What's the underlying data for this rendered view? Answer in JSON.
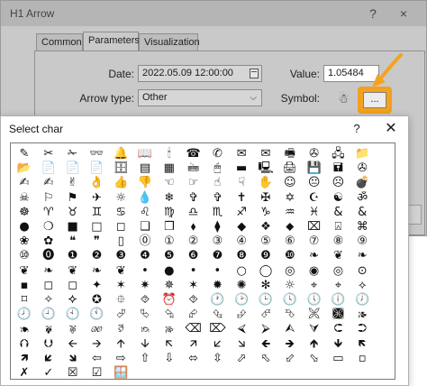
{
  "back_dialog": {
    "title": "H1 Arrow",
    "help_label": "?",
    "close_label": "×",
    "tabs": [
      {
        "label": "Common"
      },
      {
        "label": "Parameters"
      },
      {
        "label": "Visualization"
      }
    ],
    "date_label": "Date:",
    "date_value": "2022.05.09 12:00:00",
    "arrow_type_label": "Arrow type:",
    "arrow_type_value": "Other",
    "value_label": "Value:",
    "value_value": "1.05484",
    "symbol_label": "Symbol:",
    "symbol_preview": "☃",
    "browse_label": "...",
    "accent_color": "#f4a31f"
  },
  "char_dialog": {
    "title": "Select char",
    "help_label": "?",
    "close_label": "✕",
    "rows": [
      [
        "✎",
        "✂",
        "✁",
        "👓",
        "🔔",
        "📖",
        "🕯",
        "☎",
        "✆",
        "✉",
        "✉",
        "🖷",
        "✇",
        "🖧",
        "📁"
      ],
      [
        "📂",
        "📄",
        "📄",
        "📄",
        "🗄",
        "▤",
        "▦",
        "🖮",
        "🖱",
        "▬",
        "🖳",
        "🖨",
        "💾",
        "🖬",
        "✇"
      ],
      [
        "✍",
        "✍",
        "✌",
        "👌",
        "👍",
        "👎",
        "☜",
        "☞",
        "☝",
        "☟",
        "✋",
        "☺",
        "😐",
        "☹",
        "💣"
      ],
      [
        "☠",
        "⚐",
        "⚑",
        "✈",
        "☼",
        "💧",
        "❄",
        "✞",
        "✞",
        "✝",
        "✠",
        "✡",
        "☪",
        "☯",
        "ॐ"
      ],
      [
        "☸",
        "♈",
        "♉",
        "♊",
        "♋",
        "♌",
        "♍",
        "♎",
        "♏",
        "♐",
        "♑",
        "♒",
        "♓",
        "&",
        "&"
      ],
      [
        "●",
        "❍",
        "■",
        "□",
        "◻",
        "❑",
        "❒",
        "⬧",
        "⧫",
        "◆",
        "❖",
        "⬥",
        "⌧",
        "⍓",
        "⌘"
      ],
      [
        "❀",
        "✿",
        "❝",
        "❞",
        "▯",
        "⓪",
        "①",
        "②",
        "③",
        "④",
        "⑤",
        "⑥",
        "⑦",
        "⑧",
        "⑨"
      ],
      [
        "⑩",
        "⓿",
        "❶",
        "❷",
        "❸",
        "❹",
        "❺",
        "❻",
        "❼",
        "❽",
        "❾",
        "❿",
        "❧",
        "❦",
        "❧"
      ],
      [
        "❦",
        "❧",
        "❦",
        "❧",
        "❦",
        "•",
        "●",
        "•",
        "•",
        "○",
        "◯",
        "◎",
        "◉",
        "◎",
        "⊙"
      ],
      [
        "▪",
        "◻",
        "◻",
        "✦",
        "✶",
        "✷",
        "✵",
        "✶",
        "✹",
        "✺",
        "✻",
        "☼",
        "⌖",
        "⌖",
        "⟡"
      ],
      [
        "⌑",
        "✧",
        "⯎",
        "✪",
        "⯐",
        "⯑",
        "⏰",
        "⯑",
        "🕐",
        "🕑",
        "🕒",
        "🕓",
        "🕔",
        "🕕",
        "🕖"
      ],
      [
        "🕗",
        "🕘",
        "🕙",
        "🕚",
        "⮰",
        "⮱",
        "⮲",
        "⮳",
        "⮴",
        "⮵",
        "⮶",
        "⮷",
        "🙪",
        "🙫",
        "🙕"
      ],
      [
        "🙔",
        "🙗",
        "🙖",
        "🙐",
        "🙑",
        "🙒",
        "🙓",
        "⌫",
        "⌦",
        "⮘",
        "⮚",
        "⮙",
        "⮛",
        "⮈",
        "⮊"
      ],
      [
        "⮉",
        "⮋",
        "🡨",
        "🡪",
        "🡩",
        "🡫",
        "🡬",
        "🡭",
        "🡯",
        "🡮",
        "🡸",
        "🡺",
        "🡹",
        "🡻",
        "🡼"
      ],
      [
        "🡽",
        "🡿",
        "🡾",
        "⇦",
        "⇨",
        "⇧",
        "⇩",
        "⬄",
        "⇳",
        "⬀",
        "⬁",
        "⬃",
        "⬂",
        "▭",
        "▫"
      ],
      [
        "✗",
        "✓",
        "☒",
        "☑",
        "🪟"
      ]
    ]
  }
}
